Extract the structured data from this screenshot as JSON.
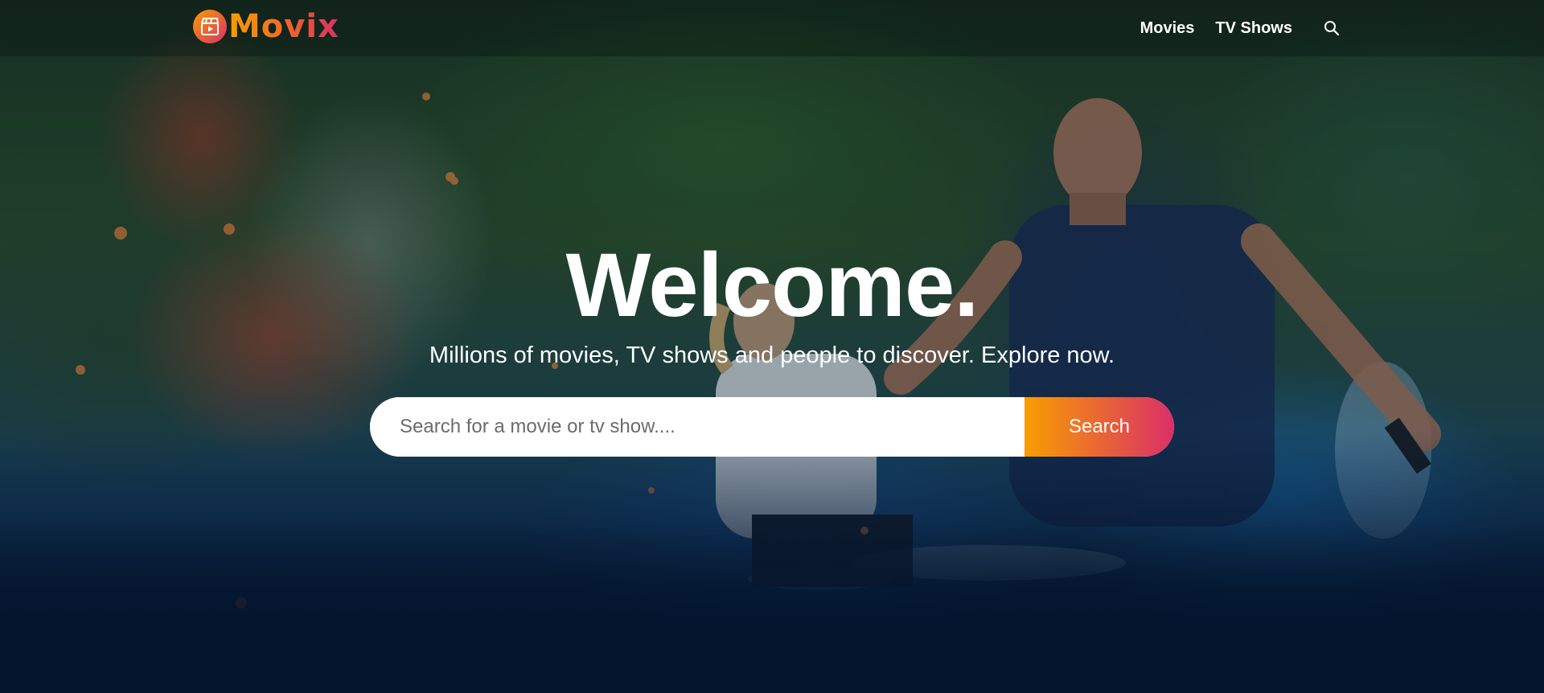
{
  "colors": {
    "accent_start": "#f89e00",
    "accent_end": "#da2f68",
    "background": "#04152d",
    "text": "#ffffff"
  },
  "header": {
    "logo_text": "Movix",
    "logo_icon": "clapperboard-play-icon",
    "nav": [
      {
        "label": "Movies"
      },
      {
        "label": "TV Shows"
      }
    ],
    "search_icon": "search-icon"
  },
  "hero": {
    "title": "Welcome.",
    "subtitle": "Millions of movies, TV shows and people to discover. Explore now.",
    "search": {
      "placeholder": "Search for a movie or tv show....",
      "value": "",
      "button_label": "Search"
    }
  }
}
